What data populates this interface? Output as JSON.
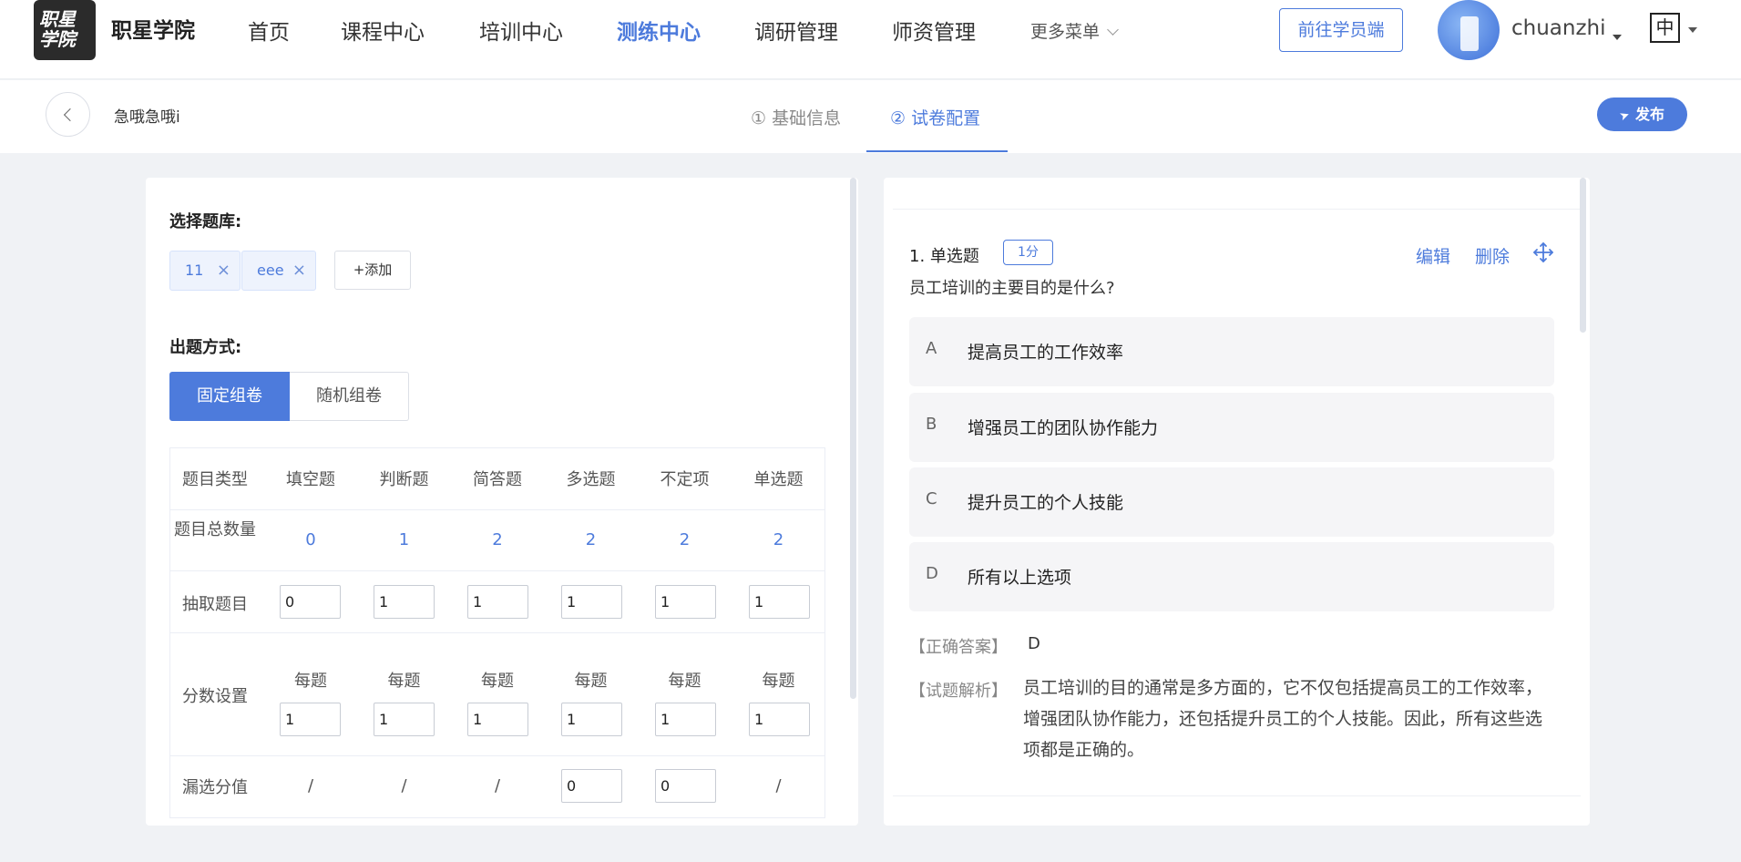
{
  "app": {
    "logo_text": "职星学院",
    "brand": "职星学院"
  },
  "nav": {
    "items": [
      "首页",
      "课程中心",
      "培训中心",
      "测练中心",
      "调研管理",
      "师资管理"
    ],
    "active": "测练中心",
    "more": "更多菜单",
    "go_student": "前往学员端",
    "username": "chuanzhi",
    "lang": "中"
  },
  "subheader": {
    "title": "急哦急哦i",
    "steps": [
      "① 基础信息",
      "② 试卷配置"
    ],
    "active_step": "② 试卷配置",
    "publish": "发布"
  },
  "left": {
    "bank_label": "选择题库:",
    "tags": [
      "11",
      "eee"
    ],
    "add": "+添加",
    "mode_label": "出题方式:",
    "modes": [
      "固定组卷",
      "随机组卷"
    ],
    "active_mode": "固定组卷",
    "table": {
      "header_label": "题目类型",
      "types": [
        "填空题",
        "判断题",
        "简答题",
        "多选题",
        "不定项",
        "单选题"
      ],
      "total_label": "题目总数量",
      "totals": [
        "0",
        "1",
        "2",
        "2",
        "2",
        "2"
      ],
      "draw_label": "抽取题目",
      "draw": [
        "0",
        "1",
        "1",
        "1",
        "1",
        "1"
      ],
      "score_label": "分数设置",
      "per_label": "每题",
      "scores": [
        "1",
        "1",
        "1",
        "1",
        "1",
        "1"
      ],
      "partial_label": "漏选分值",
      "partial": [
        "/",
        "/",
        "/",
        "0",
        "0",
        "/"
      ]
    }
  },
  "right": {
    "question_no": "1. 单选题",
    "score": "1分",
    "edit": "编辑",
    "delete": "删除",
    "question": "员工培训的主要目的是什么?",
    "options": [
      {
        "letter": "A",
        "text": "提高员工的工作效率"
      },
      {
        "letter": "B",
        "text": "增强员工的团队协作能力"
      },
      {
        "letter": "C",
        "text": "提升员工的个人技能"
      },
      {
        "letter": "D",
        "text": "所有以上选项"
      }
    ],
    "answer_label": "【正确答案】",
    "answer": "D",
    "analysis_label": "【试题解析】",
    "analysis": "员工培训的目的通常是多方面的，它不仅包括提高员工的工作效率，增强团队协作能力，还包括提升员工的个人技能。因此，所有这些选项都是正确的。"
  },
  "colors": {
    "accent": "#4d7bdc"
  }
}
